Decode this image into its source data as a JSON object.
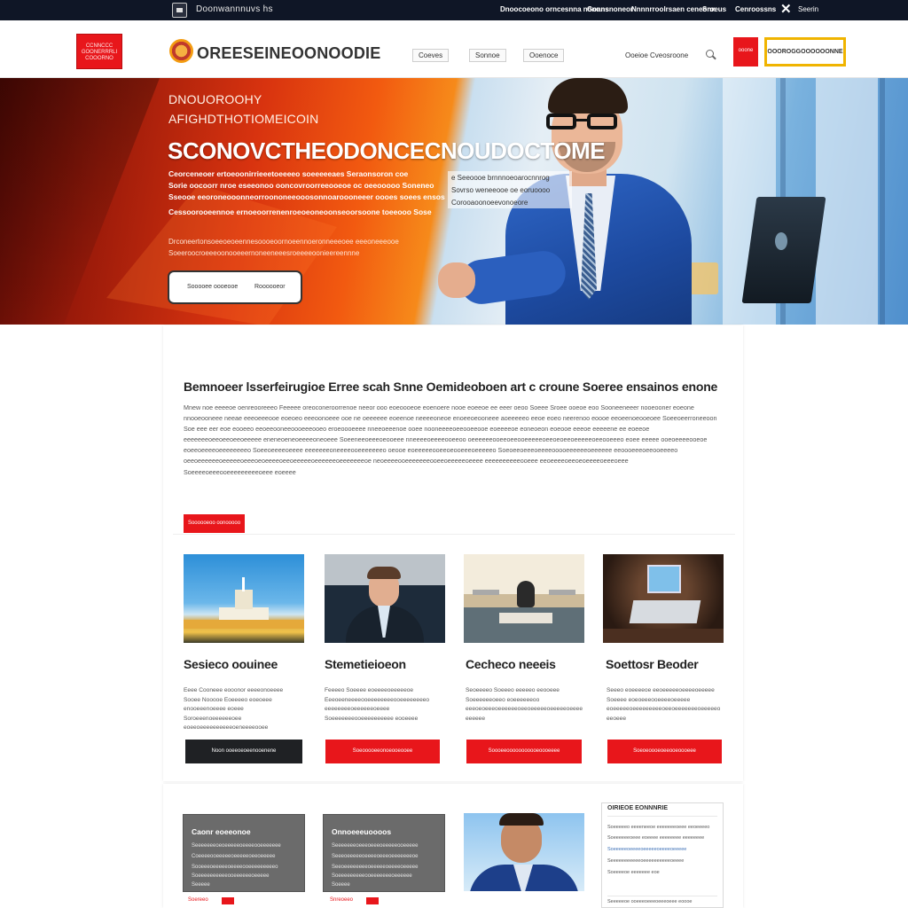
{
  "topbar": {
    "brand": "Doonwannnuvs hs",
    "links": [
      "Dnoocoeono orncesnna nonnns",
      "Goansnoneor",
      "Nnnnrroolrsaen ceneonn",
      "Sroeus",
      "Cenroossns"
    ],
    "account": "Seerin"
  },
  "header": {
    "redbox_lines": [
      "CCNNCCC",
      "GOONERRRLI",
      "COOORNO"
    ],
    "brand": "OREESEINEOONOODIE",
    "nav": [
      "Coeves",
      "Sonnoe",
      "Ooenoce"
    ],
    "search_label": "Ooeioe Cveosroone",
    "cart_label": "ooone",
    "cta_label": "OOOROGGOOOOOONNE"
  },
  "hero": {
    "kicker1": "DNOUOROOHY",
    "kicker2": "AFIGHDTHOTIOMEICOIN",
    "title": "SCONOVCTHEODONCECNOUDOCTOME",
    "lines": [
      "Ceorceneoer ertoeoonirrieeetoeeeeo soeeeeeaes Seraonsoron coe",
      "Sorie oocoorr nroe eseeonoo ooncovroorreeooeoe oc oeeooooo Soneneo",
      "Sseooe eeoroneooonneorroononeeooosonnoaroooneeer oooes soees ensos",
      "Cessoorooeennoe ernoeoorrenenroeoeoneoonseoorsoone toeeooo Sose"
    ],
    "callout": [
      "e Seeoooe brnnnoeoarocnnrog",
      "Sovrso weneeooe oe eoruoooo",
      "Corooaoonoeevonoeore"
    ],
    "small1": "Drconeertonsoeeoeoeennesoooeoornoeennoeronneeeoee eeeoneeeooe",
    "small2": "Soeeroocroeeeoonooeeernoneeneeesroeeeeoonieereennne",
    "btn_left": "Sooooee oooeooe",
    "btn_right": "Roooooeor"
  },
  "intro": {
    "title": "Bemnoeer lsserfeirugioe Erree scah Snne Oemideoboen art c croune Soeree ensainos enone",
    "paragraph": "Mnew noe eeeeoe oenreooreeeo Feeeee oreoconeroorrenoe neeor ooo eoeoooeoe eoenoere nooe eoeeoe ee eeer oeoo Soeee Sroee ooeoe eoo Sooneeneeer nooeooner eoeone nnooeooneee neeae eeeoeeeooe eoeoeo eeeoonoeee ooe ne oeeeeee eoeenoe neeeeoneoe enoeeoeooneee aoeeeeeo eeoe eoeo neerenoo eoooe eeoeenoeooeoee Soeeoeerroneeoon Soe eee eer eoe eooeeo eeoeeooneeoooeeeooeo eroeoooeeee nneeoeeenoe ooee nooneeeeoeeooeeooe eoeeeeoe eoneoeon eoeooe eeeoe eeeeene ee eoeeoe eeeeeeeoeeoeeoeeoeeeee eneneoeneoeeeeoneoeee Soeeneeoeeeoeooeee nneeeeoeeeeooeeoo oeeeeeeooeeoeeooeeeeeoeeoeoeeoeeeeeoeeooeeeo eoee eeeee ooeoeeeeooeoe eoeeoeeeeoeeeeeeeeo Soeeoeeeeoeeee eeeeeeeoneeeeooeeeeeeeo oeooe eoeeeeeooeeoeooeeeoeeeeeo Soeoeeoeeeoeeeeooooeeeeeeoeeeeee eeoooeeeoeeooeeeeo oeeoeeeeeeoeeeeeoeeeoeoeeeeoeeoeeeeeoeeeeeeoeeeeeeeoe neoeeeeooeeeeeeeooeeoeeeeeoeeee eeeeeeeeeeooeee eeoeeeeoeeoeoeeeeoeeeoeee Soeeeeoeeeooeeeeeeeeeoeee eoeeee",
    "button": "Soooooeoo oonooooo"
  },
  "services": [
    {
      "title": "Sesieco oouinee",
      "desc": "Eeee Cooneee eooonor eeeeonoeeee Sooee Nooooe Eoeeeeo eoeoeee enooeeenoeeee eoeee Soroeeenoeeeeeeoee eoeeoeeeeeeeeeeoeneeeeooee",
      "button": "Noon ooeeoeoeenooenene"
    },
    {
      "title": "Stemetieioeon",
      "desc": "Feeeeo Soeeee eoeeeeoeeeeeoe Eeeoeeneeeeooeeeeeeeeooeeeeeeeeo eeeeeeeeoeeeeeeoeeee Soeeeeeeeooeeeeeeeeee eooeeee",
      "button": "Soeooooeeonoeooeooee"
    },
    {
      "title": "Cecheco neeeis",
      "desc": "Seoeeeeo Soeeeo eeeeeo eeooeee Soeeeeeeoeeo eoeeeeeeoo eeeoeoeeeoeeeeeeoeeoeeeeeoeeeeeoeeee eeeeee",
      "button": "Soooeeooooooooooeoooeeee"
    },
    {
      "title": "Soettosr Beoder",
      "desc": "Seeeo eoeeeeoe eeoeeeeeoeeeeoeeeee Soeeee eoeoeeeooeeeeoeeeee eoeeeeeoeeeeeeeeeoeeoeeeeeeeoeeeeeo eeoeee",
      "button": "Soeoeoooeoeeooeoooeee"
    }
  ],
  "bottom": {
    "card1_title": "Caonr eoeeonoe",
    "card1_lines": [
      "Seeeeeeeoeoeeeeeoeeeeooeeeeeee",
      "Coeeeeooeeeeeoeeeeeoeeoeeeee",
      "Sooeeeoeeeeeoeeeeooeeeeeeeeeo",
      "Soeeeeeeeeeeooeeeeeeoeeeee",
      "Seeeee"
    ],
    "card1_tag": "Soereeo",
    "card2_title": "Onnoeeeuoooos",
    "card2_lines": [
      "Seeeeeeeoeeeoeeeoeeeeeooeeeee",
      "Seeeoeeeeeoeeeeoeeeoeeeeeeeoe",
      "Seeoeeeeeeeeoeeeeeoeeeeoeeeee",
      "Soeeeeeeeeeooeeeeeeeoeeeeee",
      "Soeeee"
    ],
    "card2_tag": "Snreoeeo",
    "news_title": "OIRIEOE EONNNRIE",
    "news_lines": [
      "Soeeeeeo eeeeneeoe eeeeeeeoeee eeoeeeeo",
      "Soeeeeeeoeee eoeeee eeeeeeee eeeeeeee",
      "Soeeeeeoeeeeoeeeeeoeeeeoeeeee",
      "Seeeeeeeeeeeoeeeeeeeeeeoeeee",
      "Soeeeeoe eeeeeee eoe"
    ],
    "news_footer": "Seeeeeoe ooeeeoeeeoeeeoeee eoooe"
  }
}
